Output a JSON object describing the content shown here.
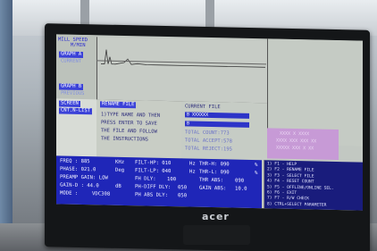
{
  "scene": {
    "brand": "acer"
  },
  "screen": {
    "header": {
      "line1": "MILL SPEED",
      "line2": "M/MIN"
    },
    "graphs": [
      "GRAPH A",
      "CURRENT",
      "GRAPH B",
      "PREVIOUS",
      "SCREEN",
      "CNT.N-LIST"
    ],
    "left_panel": {
      "title": "RENAME FILE",
      "lines": [
        "1)TYPE NAME AND THEN",
        "PRESS ENTER TO SAVE",
        "THE FILE AND FOLLOW",
        "THE INSTRUCTIONS"
      ]
    },
    "right_panel": {
      "title": "CURRENT FILE",
      "file_bar": "B XXXXXX",
      "second_bar": "B",
      "stats": [
        "TOTAL COUNT:773",
        "TOTAL ACCEPT:578",
        "TOTAL REJECT:195"
      ]
    },
    "pink_box": [
      "XXXX X XXXX",
      "XXXX XXX XXX XX",
      "XXXXX XXX X XX"
    ],
    "params": [
      [
        "FREQ : 885",
        "KHz",
        "FILT-HP: 010",
        "Hz",
        "THR-H: 090",
        "%"
      ],
      [
        "PHASE: 021.0",
        "Deg",
        "FILT-LP: 040",
        "Hz",
        "THR-L: 090",
        "%"
      ],
      [
        "PREAMP GAIN: LOW",
        "",
        "FH DLY:",
        "100",
        "THR ABS:",
        "090"
      ],
      [
        "GAIN-D : 44.0",
        "dB",
        "PH-DIFF DLY:",
        "050",
        "GAIN ABS:",
        "10.0"
      ],
      [
        "MODE :",
        "VDC308",
        "PH ABS DLY:",
        "050",
        "",
        ""
      ]
    ],
    "fkeys": [
      "1) F1 - HELP",
      "2) F2 - RENAME FILE",
      "3) F3 - SELECT FILE",
      "4) F4 - RESET COUNT",
      "5) F5 - OFFLINE/ONLINE SEL.",
      "6) F6 - EXIT",
      "7) F7 - R/W CHECK",
      "8) CTRL+SELECT PARAMETER"
    ]
  }
}
